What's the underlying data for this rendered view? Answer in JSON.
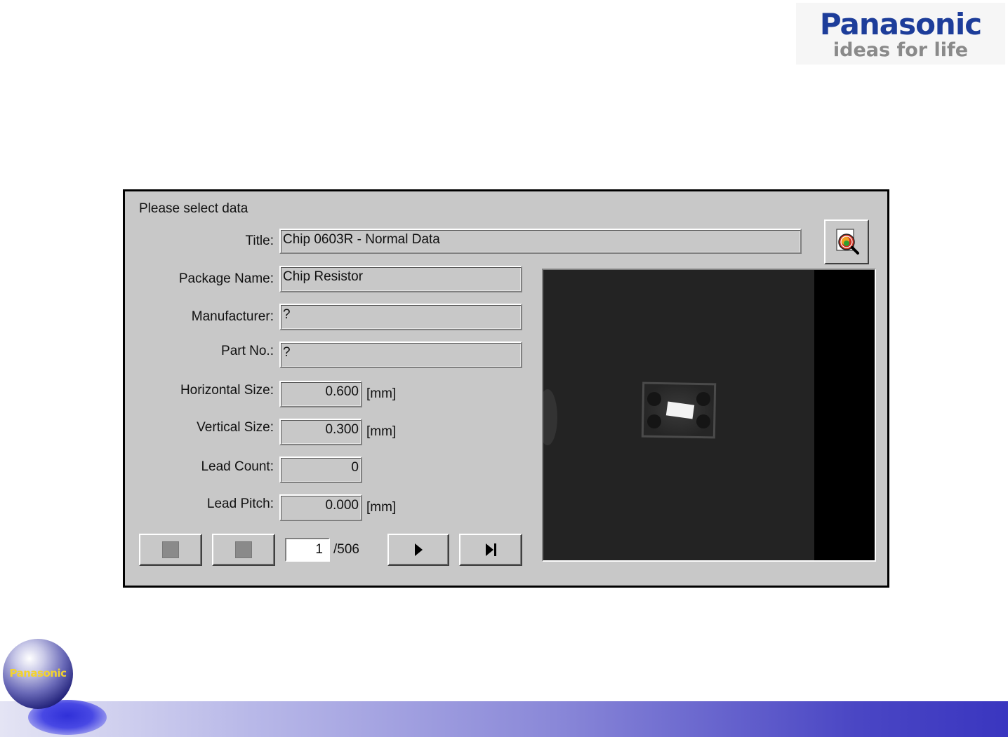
{
  "brand": {
    "name": "Panasonic",
    "tagline": "ideas for life",
    "orb_label": "Panasonic"
  },
  "dialog": {
    "prompt": "Please select data",
    "fields": {
      "title": {
        "label": "Title:",
        "value": "Chip 0603R - Normal Data"
      },
      "package_name": {
        "label": "Package Name:",
        "value": "Chip Resistor"
      },
      "manufacturer": {
        "label": "Manufacturer:",
        "value": "?"
      },
      "part_no": {
        "label": "Part No.:",
        "value": "?"
      },
      "horizontal_size": {
        "label": "Horizontal Size:",
        "value": "0.600",
        "unit": "[mm]"
      },
      "vertical_size": {
        "label": "Vertical Size:",
        "value": "0.300",
        "unit": "[mm]"
      },
      "lead_count": {
        "label": "Lead Count:",
        "value": "0"
      },
      "lead_pitch": {
        "label": "Lead Pitch:",
        "value": "0.000",
        "unit": "[mm]"
      }
    },
    "navigation": {
      "current_page": "1",
      "total_label": "/506"
    },
    "icons": {
      "first": "disabled-square-icon",
      "prev": "disabled-square-icon",
      "next": "play-right-icon",
      "last": "skip-to-end-icon",
      "search": "search-magnifier-icon"
    }
  }
}
